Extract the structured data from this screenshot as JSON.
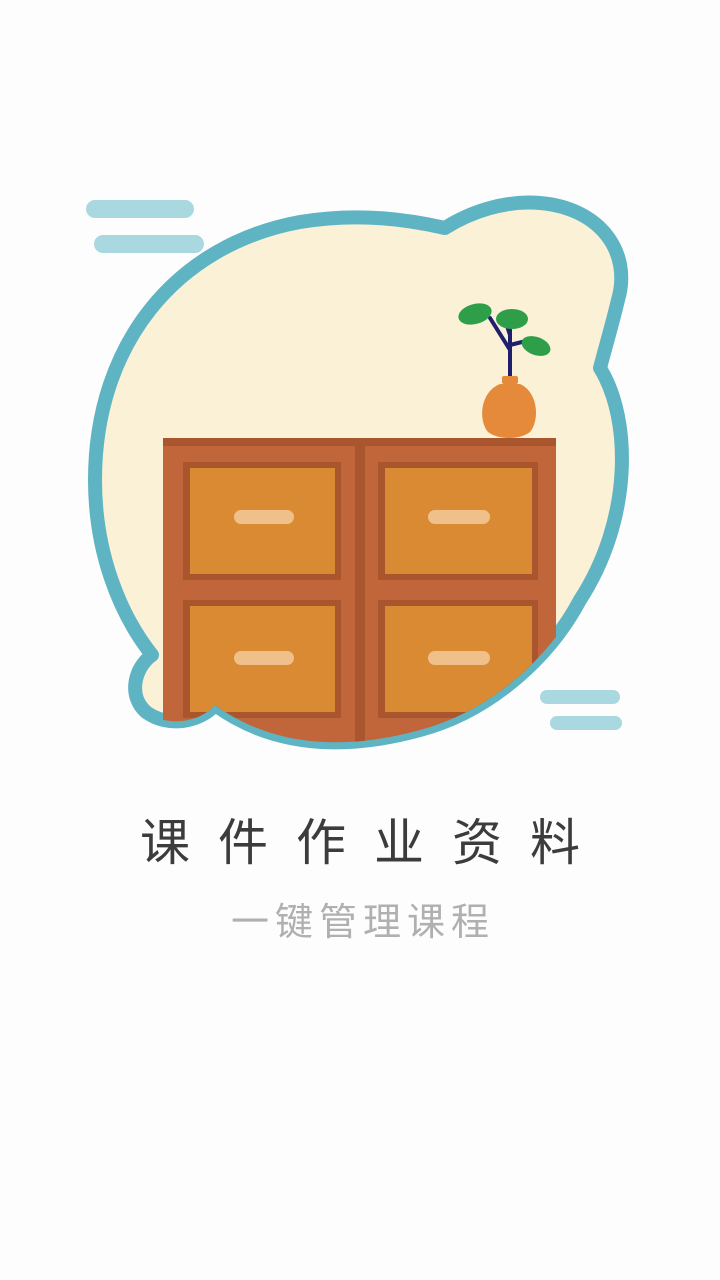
{
  "splash": {
    "title": "课件作业资料",
    "subtitle": "一键管理课程"
  },
  "illustration": {
    "subject": "filing-cabinet-with-plant",
    "colors": {
      "background": "#fdfdfd",
      "blob_fill": "#faf1d6",
      "blob_border": "#5fb4c4",
      "cloud": "#a9d8e0",
      "cabinet_frame": "#c0663a",
      "drawer": "#d98a33",
      "handle": "#f0c08a",
      "vase": "#e58a3a",
      "leaf": "#2e9e48",
      "stem": "#1f1f6e"
    }
  }
}
